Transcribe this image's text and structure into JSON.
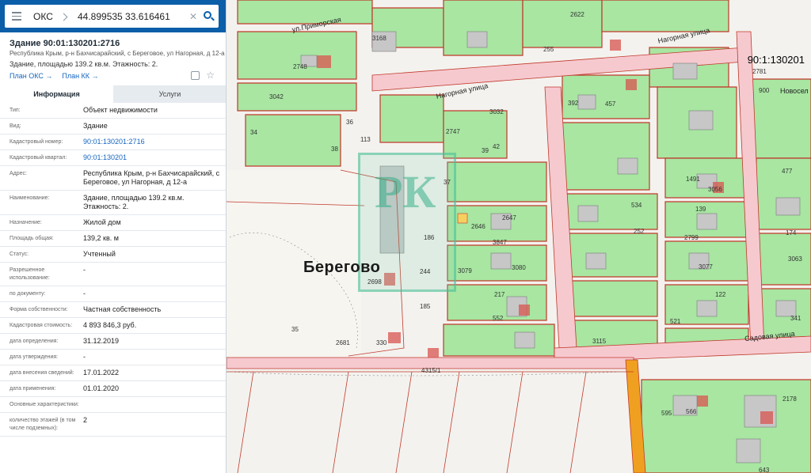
{
  "search": {
    "type_label": "ОКС",
    "query": "44.899535 33.616461",
    "clear_glyph": "✕"
  },
  "object": {
    "title": "Здание 90:01:130201:2716",
    "address": "Республика Крым, р-н Бахчисарайский, с Береговое, ул Нагорная, д 12-а",
    "description": "Здание, площадью 139.2 кв.м. Этажность: 2.",
    "link_oks": "План ОКС →",
    "link_kk": "План КК →"
  },
  "tabs": [
    {
      "label": "Информация",
      "active": true
    },
    {
      "label": "Услуги",
      "active": false
    }
  ],
  "info_rows": [
    {
      "key": "Тип:",
      "value": "Объект недвижимости",
      "link": false
    },
    {
      "key": "Вид:",
      "value": "Здание",
      "link": false
    },
    {
      "key": "Кадастровый номер:",
      "value": "90:01:130201:2716",
      "link": true
    },
    {
      "key": "Кадастровый квартал:",
      "value": "90:01:130201",
      "link": true
    },
    {
      "key": "Адрес:",
      "value": "Республика Крым, р-н Бахчисарайский, с Береговое, ул Нагорная, д 12-а",
      "link": false
    },
    {
      "key": "Наименование:",
      "value": "Здание, площадью 139.2 кв.м. Этажность: 2.",
      "link": false
    },
    {
      "key": "Назначение:",
      "value": "Жилой дом",
      "link": false
    },
    {
      "key": "Площадь общая:",
      "value": "139,2 кв. м",
      "link": false
    },
    {
      "key": "Статус:",
      "value": "Учтенный",
      "link": false
    },
    {
      "key": "Разрешенное использование:",
      "value": "-",
      "link": false
    },
    {
      "key": "по документу:",
      "value": "-",
      "link": false
    },
    {
      "key": "Форма собственности:",
      "value": "Частная собственность",
      "link": false
    },
    {
      "key": "Кадастровая стоимость:",
      "value": "4 893 846,3 руб.",
      "link": false
    },
    {
      "key": "дата определения:",
      "value": "31.12.2019",
      "link": false
    },
    {
      "key": "дата утверждения:",
      "value": "-",
      "link": false
    },
    {
      "key": "дата внесения сведений:",
      "value": "17.01.2022",
      "link": false
    },
    {
      "key": "дата применения:",
      "value": "01.01.2020",
      "link": false
    },
    {
      "key": "Основные характеристики:",
      "value": "",
      "link": false
    },
    {
      "key": "количество этажей (в том числе подземных):",
      "value": "2",
      "link": false
    }
  ],
  "map": {
    "village_label": "Берегово",
    "cadastral_quarter_label": "90:1:130201",
    "streets": [
      "ул.Приморская",
      "Нагорная улица",
      "Нагорная улица",
      "Садовая улица",
      "Новосел"
    ],
    "parcel_numbers": [
      "2748",
      "3042",
      "3168",
      "2622",
      "255",
      "2747",
      "3032",
      "2781",
      "392",
      "457",
      "900",
      "113",
      "1491",
      "3056",
      "477",
      "534",
      "139",
      "2647",
      "2646",
      "252",
      "2799",
      "174",
      "3847",
      "3063",
      "186",
      "244",
      "3079",
      "3080",
      "3077",
      "2698",
      "185",
      "217",
      "122",
      "552",
      "521",
      "341",
      "2681",
      "330",
      "3115",
      "4315/1",
      "2178",
      "595",
      "566",
      "643",
      "36",
      "35",
      "37",
      "39",
      "42",
      "34",
      "38"
    ],
    "watermark_letters": "РК",
    "colors": {
      "parcel_green": "#a8e6a2",
      "parcel_border": "#c0392b",
      "road_pink": "#f6c9cf",
      "selected_orange": "#f0a020"
    }
  }
}
